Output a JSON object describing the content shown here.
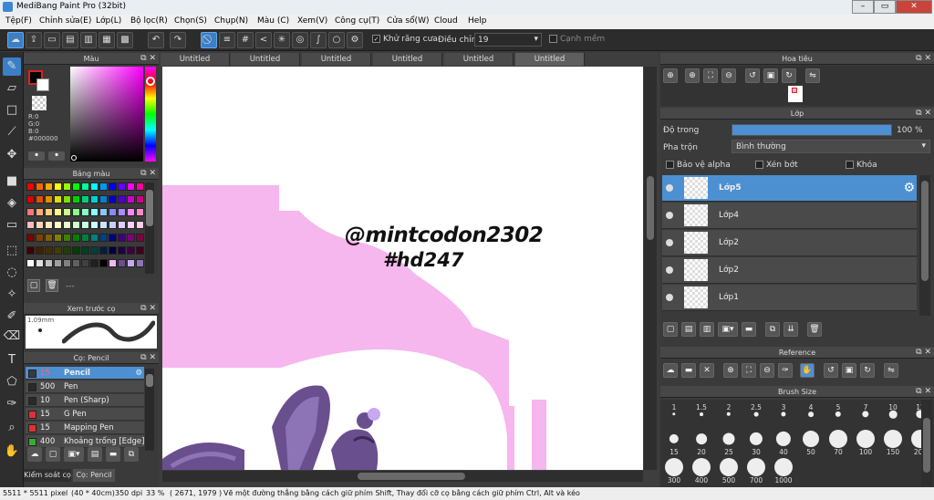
{
  "window": {
    "title": "MediBang Paint Pro (32bit)",
    "minimize": "–",
    "maximize": "▭",
    "close": "✕"
  },
  "menu": [
    "Tệp(F)",
    "Chỉnh sửa(E)",
    "Lớp(L)",
    "Bộ lọc(R)",
    "Chọn(S)",
    "Chụp(N)",
    "Màu (C)",
    "Xem(V)",
    "Công cụ(T)",
    "Cửa sổ(W)",
    "Cloud",
    "Help"
  ],
  "toolbar": {
    "antialias_label": "Khử răng cưa",
    "adjust_label": "Điều chỉnh",
    "adjust_value": "19",
    "snap_label": "Cạnh mềm"
  },
  "color_panel": {
    "title": "Màu",
    "r": "R:0",
    "g": "G:0",
    "b": "B:0",
    "hex": "#000000"
  },
  "palette_panel": {
    "title": "Bảng màu",
    "more": "---"
  },
  "preview_panel": {
    "title": "Xem trước cọ",
    "size": "1.09mm"
  },
  "brush_panel": {
    "title": "Cọ: Pencil",
    "items": [
      {
        "size": "15",
        "name": "Pencil",
        "color": "#3a3a3a",
        "selected": true
      },
      {
        "size": "500",
        "name": "Pen",
        "color": "#2a2a2a"
      },
      {
        "size": "10",
        "name": "Pen (Sharp)",
        "color": "#2a2a2a"
      },
      {
        "size": "15",
        "name": "G Pen",
        "color": "#e03030"
      },
      {
        "size": "15",
        "name": "Mapping Pen",
        "color": "#e03030"
      },
      {
        "size": "400",
        "name": "Khoảng trống [Edge]",
        "color": "#30b030"
      }
    ]
  },
  "bottom_tabs": [
    "Kiểm soát cọ",
    "Cọ: Pencil"
  ],
  "canvas_tabs": [
    "Untitled",
    "Untitled",
    "Untitled",
    "Untitled",
    "Untitled",
    "Untitled"
  ],
  "canvas_text": {
    "line1": "@mintcodon2302",
    "line2": "#hd247"
  },
  "navigator": {
    "title": "Hoa tiêu"
  },
  "layer_panel": {
    "title": "Lớp",
    "opacity_label": "Độ trong",
    "opacity_value": "100 %",
    "opacity_fraction": 1.0,
    "blend_label": "Pha trộn",
    "blend_value": "Bình thường",
    "protect_alpha": "Bảo vệ alpha",
    "clipping": "Xén bớt",
    "lock": "Khóa",
    "layers": [
      {
        "name": "Lớp5",
        "selected": true
      },
      {
        "name": "Lớp4"
      },
      {
        "name": "Lớp2"
      },
      {
        "name": "Lớp2"
      },
      {
        "name": "Lớp1"
      }
    ]
  },
  "reference_panel": {
    "title": "Reference"
  },
  "brush_size_panel": {
    "title": "Brush Size",
    "sizes": [
      "1",
      "1.5",
      "2",
      "2.5",
      "3",
      "4",
      "5",
      "7",
      "10",
      "12",
      "15",
      "20",
      "25",
      "30",
      "40",
      "50",
      "70",
      "100",
      "150",
      "200",
      "300",
      "400",
      "500",
      "700",
      "1000"
    ]
  },
  "status": {
    "dimensions": "5511 * 5511 pixel",
    "physical": "(40 * 40cm)",
    "dpi": "350 dpi",
    "zoom": "33 %",
    "coords": "( 2671, 1979 )",
    "hint": "Vẽ một đường thẳng bằng cách giữ phím Shift, Thay đổi cỡ cọ bằng cách giữ phím Ctrl, Alt và kéo"
  },
  "colors": {
    "accent": "#4d90d2",
    "canvas_pink": "#f6b6ee",
    "purple_art": "#6a4f8f"
  }
}
